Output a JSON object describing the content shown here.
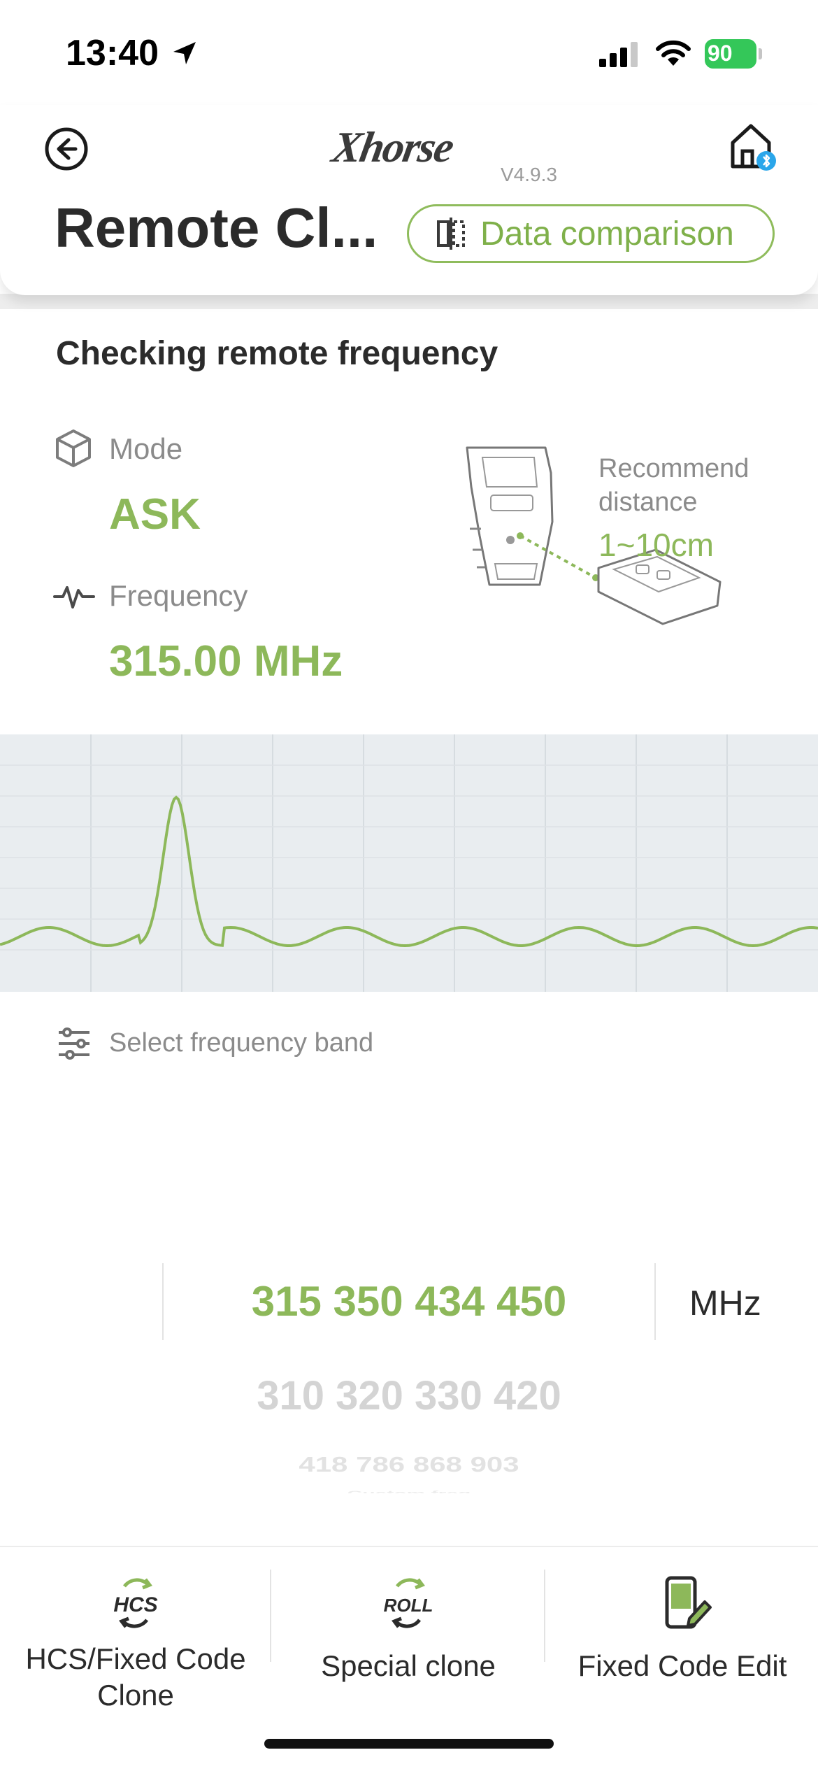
{
  "status_bar": {
    "time": "13:40",
    "battery": "90",
    "icons": [
      "location-arrow-icon",
      "cellular-signal-icon",
      "wifi-icon",
      "battery-charging-icon"
    ]
  },
  "header": {
    "brand": "Xhorse",
    "version": "V4.9.3",
    "title": "Remote Cl...",
    "data_comparison_label": "Data comparison",
    "icons": [
      "back-arrow-icon",
      "home-bluetooth-icon",
      "compare-icon"
    ]
  },
  "checking": {
    "title": "Checking remote frequency",
    "mode_label": "Mode",
    "mode_value": "ASK",
    "frequency_label": "Frequency",
    "frequency_value": "315.00 MHz",
    "recommend_label": "Recommend distance",
    "recommend_value": "1~10cm"
  },
  "band_selector": {
    "label": "Select frequency band",
    "selected": "315 350 434 450",
    "unit": "MHz",
    "options": [
      "310 320 330 420",
      "418 786 868 903",
      "Custom freq"
    ]
  },
  "bottom_nav": [
    {
      "label": "HCS/Fixed Code Clone",
      "icon": "hcs-icon"
    },
    {
      "label": "Special clone",
      "icon": "roll-icon"
    },
    {
      "label": "Fixed Code Edit",
      "icon": "edit-phone-icon"
    }
  ],
  "colors": {
    "accent_green": "#8db85a",
    "graph_background": "#e9edf0",
    "text_dark": "#2b2b2b",
    "text_muted": "#8b8b8b"
  }
}
